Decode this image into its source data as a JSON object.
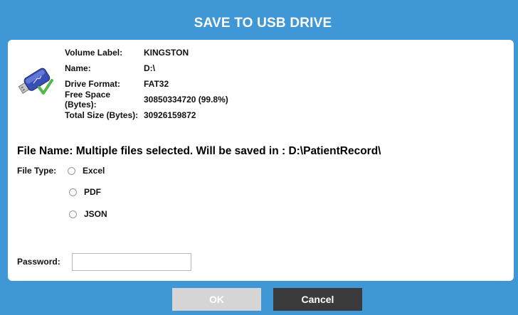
{
  "dialog": {
    "title": "SAVE TO USB DRIVE"
  },
  "drive": {
    "icon": "usb-drive-check-icon",
    "rows": [
      {
        "label": "Volume Label:",
        "value": "KINGSTON"
      },
      {
        "label": "Name:",
        "value": "D:\\"
      },
      {
        "label": "Drive Format:",
        "value": "FAT32"
      },
      {
        "label": "Free Space (Bytes):",
        "value": "30850334720 (99.8%)"
      },
      {
        "label": "Total Size (Bytes):",
        "value": "30926159872"
      }
    ]
  },
  "file": {
    "name_text": "File Name:  Multiple files selected.  Will be saved in : D:\\PatientRecord\\",
    "type_label": "File Type:",
    "types": [
      {
        "label": "Excel",
        "selected": false
      },
      {
        "label": "PDF",
        "selected": false
      },
      {
        "label": "JSON",
        "selected": false
      }
    ]
  },
  "password": {
    "label": "Password:",
    "value": "",
    "placeholder": ""
  },
  "buttons": {
    "ok": "OK",
    "cancel": "Cancel"
  },
  "colors": {
    "background": "#3f97d6",
    "panel": "#ffffff",
    "ok_disabled": "#d5d5d5",
    "cancel": "#3b3b3b",
    "check": "#52b848"
  }
}
